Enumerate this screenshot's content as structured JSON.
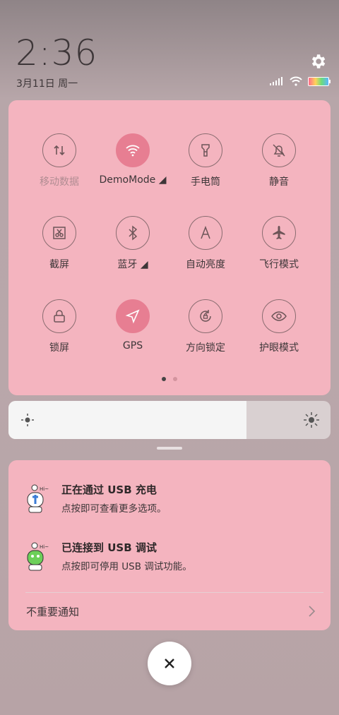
{
  "header": {
    "time": "2:36",
    "date": "3月11日 周一"
  },
  "quick_settings": {
    "tiles": [
      {
        "label": "移动数据",
        "icon": "mobile-data-icon",
        "active": false,
        "dim": true
      },
      {
        "label": "DemoMode ◢",
        "icon": "wifi-icon",
        "active": true
      },
      {
        "label": "手电筒",
        "icon": "flashlight-icon",
        "active": false
      },
      {
        "label": "静音",
        "icon": "mute-bell-icon",
        "active": false
      },
      {
        "label": "截屏",
        "icon": "screenshot-icon",
        "active": false
      },
      {
        "label": "蓝牙 ◢",
        "icon": "bluetooth-icon",
        "active": false
      },
      {
        "label": "自动亮度",
        "icon": "auto-brightness-icon",
        "active": false
      },
      {
        "label": "飞行模式",
        "icon": "airplane-icon",
        "active": false
      },
      {
        "label": "锁屏",
        "icon": "lock-icon",
        "active": false
      },
      {
        "label": "GPS",
        "icon": "gps-icon",
        "active": true
      },
      {
        "label": "方向锁定",
        "icon": "rotation-lock-icon",
        "active": false
      },
      {
        "label": "护眼模式",
        "icon": "eye-icon",
        "active": false
      }
    ],
    "page_indicator": {
      "pages": 2,
      "current": 1
    }
  },
  "brightness": {
    "level": 0.74
  },
  "notifications": [
    {
      "title": "正在通过 USB 充电",
      "text": "点按即可查看更多选项。",
      "icon": "usb-charging-robot-icon"
    },
    {
      "title": "已连接到 USB 调试",
      "text": "点按即可停用 USB 调试功能。",
      "icon": "usb-debug-robot-icon"
    }
  ],
  "minor_notifications_label": "不重要通知",
  "colors": {
    "accent": "#e77e92",
    "panel": "#f4b4bf"
  }
}
